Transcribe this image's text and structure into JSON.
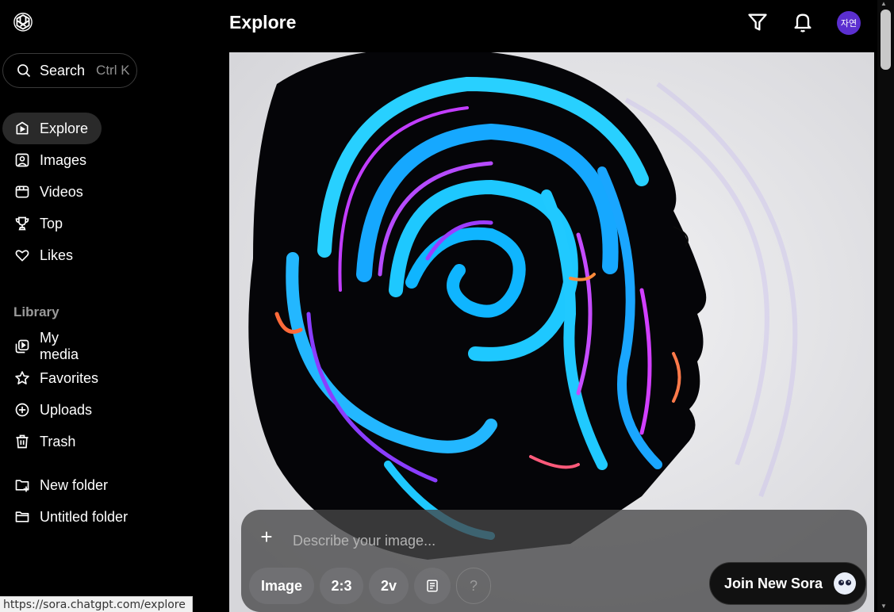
{
  "app": {
    "logo_icon": "openai-logo-icon"
  },
  "header": {
    "title": "Explore",
    "filter_icon": "filter-icon",
    "bell_icon": "bell-icon",
    "avatar_text": "자연",
    "avatar_color": "#5b2fd0"
  },
  "sidebar": {
    "search": {
      "label": "Search",
      "shortcut": "Ctrl K",
      "icon": "search-icon"
    },
    "nav": [
      {
        "label": "Explore",
        "icon": "explore-icon",
        "active": true
      },
      {
        "label": "Images",
        "icon": "image-icon"
      },
      {
        "label": "Videos",
        "icon": "video-icon"
      },
      {
        "label": "Top",
        "icon": "trophy-icon"
      },
      {
        "label": "Likes",
        "icon": "heart-icon"
      }
    ],
    "library_title": "Library",
    "library": [
      {
        "label": "My media",
        "icon": "media-icon"
      },
      {
        "label": "Favorites",
        "icon": "star-icon"
      },
      {
        "label": "Uploads",
        "icon": "upload-icon"
      },
      {
        "label": "Trash",
        "icon": "trash-icon"
      }
    ],
    "folders": [
      {
        "label": "New folder",
        "icon": "folder-plus-icon"
      },
      {
        "label": "Untitled folder",
        "icon": "folder-icon"
      }
    ]
  },
  "composer": {
    "placeholder": "Describe your image...",
    "add_icon": "plus-icon",
    "chips": [
      {
        "label": "Image"
      },
      {
        "label": "2:3"
      },
      {
        "label": "2v"
      },
      {
        "label": "",
        "icon": "preset-icon"
      },
      {
        "label": "?"
      }
    ],
    "join_label": "Join New Sora",
    "join_icon": "ghost-icon"
  },
  "status_url": "https://sora.chatgpt.com/explore",
  "colors": {
    "accent": "#5b2fd0",
    "background": "#000000"
  }
}
